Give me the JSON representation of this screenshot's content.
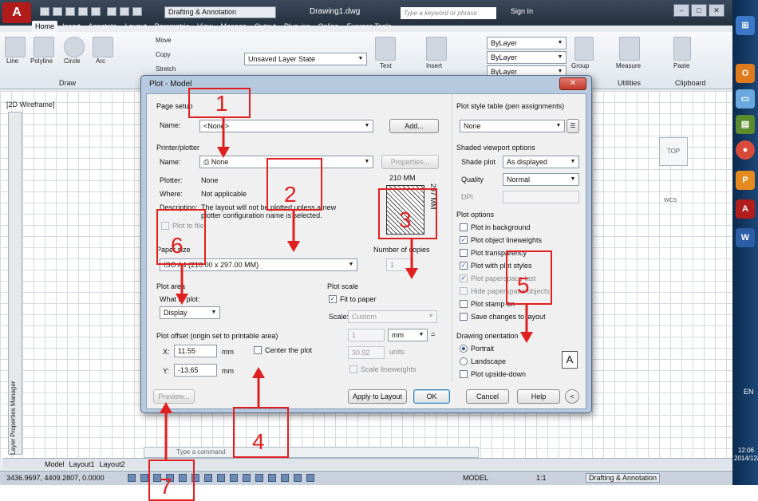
{
  "titlebar": {
    "logo": "A",
    "workspace": "Drafting & Annotation",
    "document": "Drawing1.dwg",
    "search_placeholder": "Type a keyword or phrase",
    "signin": "Sign In"
  },
  "ribbon_tabs": [
    "Home",
    "Insert",
    "Annotate",
    "Layout",
    "Parametric",
    "View",
    "Manage",
    "Output",
    "Plug-ins",
    "Online",
    "Express Tools"
  ],
  "ribbon": {
    "draw_tools": [
      "Line",
      "Polyline",
      "Circle",
      "Arc"
    ],
    "modify_tools": [
      "Move",
      "Copy",
      "Stretch"
    ],
    "layer_state": "Unsaved Layer State",
    "text_tool": "Text",
    "insert_tool": "Insert",
    "group_tool": "Group",
    "measure_tool": "Measure",
    "paste_tool": "Paste",
    "bylayer": [
      "ByLayer",
      "ByLayer",
      "ByLayer"
    ],
    "groups": {
      "draw": "Draw",
      "utilities": "Utilities",
      "clipboard": "Clipboard"
    }
  },
  "viewport": {
    "label": "[2D Wireframe]",
    "viewcube": "TOP",
    "wcs": "WCS",
    "layer_manager": "Layer Properties Manager",
    "command_prompt": "Type a command"
  },
  "layout_tabs": [
    "Model",
    "Layout1",
    "Layout2"
  ],
  "status": {
    "coords": "3436.9697, 4409.2807, 0.0000",
    "model": "MODEL",
    "scale": "1:1",
    "workspace": "Drafting & Annotation"
  },
  "taskbar": {
    "lang": "EN",
    "time": "12:06",
    "date": "2014/12/"
  },
  "dialog": {
    "title": "Plot - Model",
    "page_setup": {
      "heading": "Page setup",
      "name_label": "Name:",
      "name_value": "<None>",
      "add_button": "Add..."
    },
    "printer": {
      "heading": "Printer/plotter",
      "name_label": "Name:",
      "name_value": "None",
      "properties_button": "Properties...",
      "plotter_label": "Plotter:",
      "plotter_value": "None",
      "where_label": "Where:",
      "where_value": "Not applicable",
      "description_label": "Description:",
      "description_value": "The layout will not be plotted unless a new plotter configuration name is selected.",
      "plot_to_file": "Plot to file",
      "preview_dim_w": "210 MM",
      "preview_dim_h": "297 MM"
    },
    "paper_size": {
      "heading": "Paper size",
      "value": "ISO A4 (210.00 x 297.00 MM)"
    },
    "copies": {
      "heading": "Number of copies",
      "value": "1"
    },
    "plot_area": {
      "heading": "Plot area",
      "what_label": "What to plot:",
      "value": "Display"
    },
    "plot_offset": {
      "heading": "Plot offset (origin set to printable area)",
      "x_label": "X:",
      "x_value": "11.55",
      "x_unit": "mm",
      "y_label": "Y:",
      "y_value": "-13.65",
      "y_unit": "mm",
      "center_label": "Center the plot"
    },
    "plot_scale": {
      "heading": "Plot scale",
      "fit_label": "Fit to paper",
      "scale_label": "Scale:",
      "scale_value": "Custom",
      "value1": "1",
      "unit1": "mm",
      "value2": "30.92",
      "unit2": "units",
      "lineweights_label": "Scale lineweights",
      "equals": "="
    },
    "style_table": {
      "heading": "Plot style table (pen assignments)",
      "value": "None"
    },
    "shaded": {
      "heading": "Shaded viewport options",
      "shade_label": "Shade plot",
      "shade_value": "As displayed",
      "quality_label": "Quality",
      "quality_value": "Normal",
      "dpi_label": "DPI"
    },
    "plot_options": {
      "heading": "Plot options",
      "items": [
        "Plot in background",
        "Plot object lineweights",
        "Plot transparency",
        "Plot with plot styles",
        "Plot paperspace last",
        "Hide paperspace objects",
        "Plot stamp on",
        "Save changes to layout"
      ]
    },
    "orientation": {
      "heading": "Drawing orientation",
      "portrait": "Portrait",
      "landscape": "Landscape",
      "upside_down": "Plot upside-down",
      "glyph": "A"
    },
    "buttons": {
      "preview": "Preview...",
      "apply": "Apply to Layout",
      "ok": "OK",
      "cancel": "Cancel",
      "help": "Help",
      "expand": "<"
    }
  },
  "annotations": [
    "1",
    "2",
    "3",
    "4",
    "5",
    "6",
    "7"
  ],
  "colors": {
    "annotation": "#e02020",
    "titlebar": "#2e3b4b",
    "dialog_frame": "#b7c9de"
  }
}
